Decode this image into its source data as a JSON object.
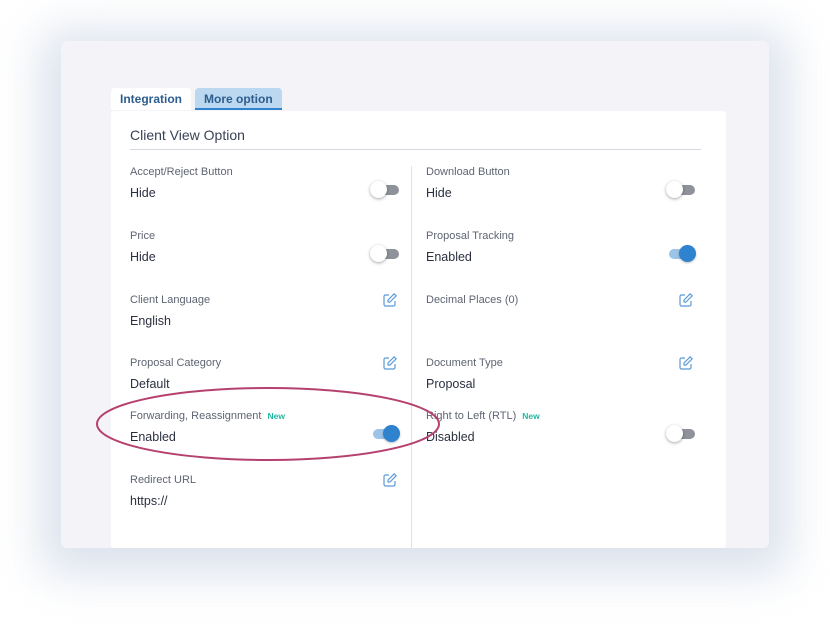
{
  "tabs": [
    {
      "label": "Integration",
      "active": false
    },
    {
      "label": "More option",
      "active": true
    }
  ],
  "section": {
    "title": "Client View Option"
  },
  "fields": {
    "accept_reject": {
      "label": "Accept/Reject Button",
      "value": "Hide",
      "toggle": "off"
    },
    "download_button": {
      "label": "Download Button",
      "value": "Hide",
      "toggle": "off"
    },
    "price": {
      "label": "Price",
      "value": "Hide",
      "toggle": "off"
    },
    "proposal_tracking": {
      "label": "Proposal Tracking",
      "value": "Enabled",
      "toggle": "on"
    },
    "client_language": {
      "label": "Client Language",
      "value": "English",
      "control": "edit-icon"
    },
    "decimal_places": {
      "label": "Decimal Places (0)",
      "value": "",
      "control": "edit-icon"
    },
    "proposal_category": {
      "label": "Proposal Category",
      "value": "Default",
      "control": "edit-icon"
    },
    "document_type": {
      "label": "Document Type",
      "value": "Proposal",
      "control": "edit-icon"
    },
    "forwarding": {
      "label": "Forwarding, Reassignment",
      "badge": "New",
      "value": "Enabled",
      "toggle": "on"
    },
    "rtl": {
      "label": "Right to Left (RTL)",
      "badge": "New",
      "value": "Disabled",
      "toggle": "off"
    },
    "redirect_url": {
      "label": "Redirect URL",
      "value": "https://",
      "control": "edit-icon"
    }
  },
  "colors": {
    "accent": "#2f82cd",
    "badge": "#1fb8a2",
    "highlight": "#b5426e"
  }
}
